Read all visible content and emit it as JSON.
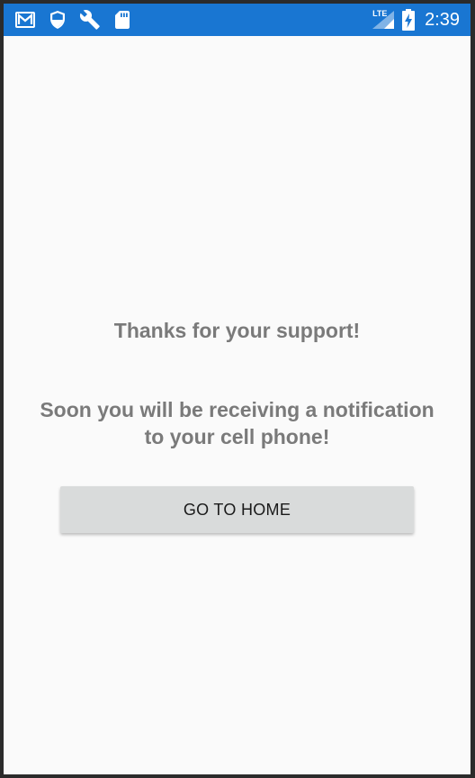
{
  "status_bar": {
    "icons": [
      "gmail-icon",
      "shield-icon",
      "wrench-icon",
      "sd-card-icon"
    ],
    "network": "LTE",
    "time": "2:39",
    "color": "#1976d2"
  },
  "main": {
    "thanks_text": "Thanks for your support!",
    "notice_text": "Soon you will be receiving a notification to your cell phone!",
    "home_button_label": "GO TO HOME"
  }
}
